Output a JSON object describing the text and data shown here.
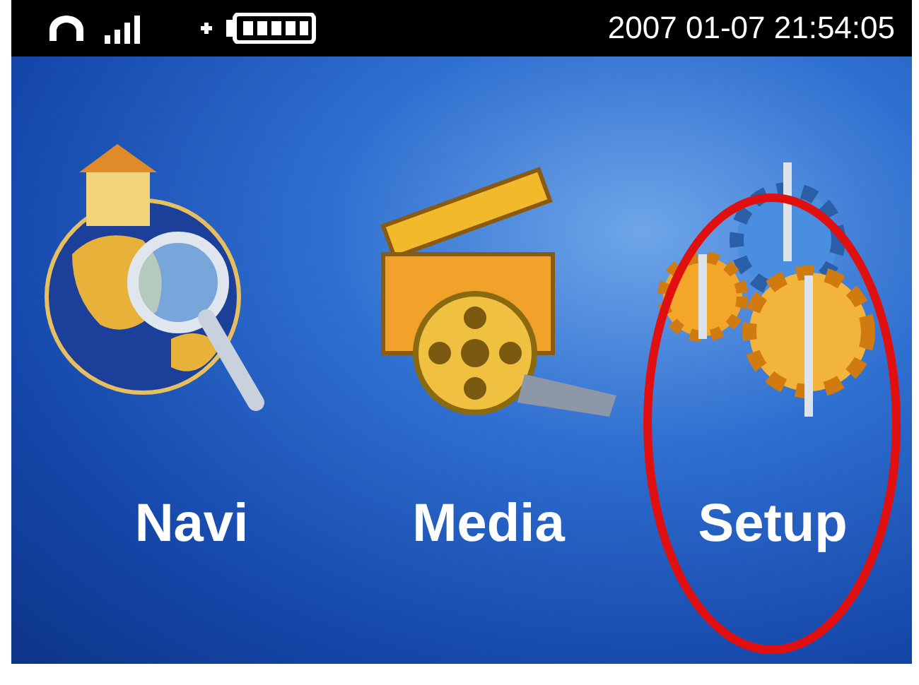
{
  "status_bar": {
    "datetime": "2007 01-07 21:54:05"
  },
  "menu": [
    {
      "kind": "navi",
      "label": "Navi",
      "selected": false
    },
    {
      "kind": "media",
      "label": "Media",
      "selected": false
    },
    {
      "kind": "setup",
      "label": "Setup",
      "selected": true
    }
  ]
}
